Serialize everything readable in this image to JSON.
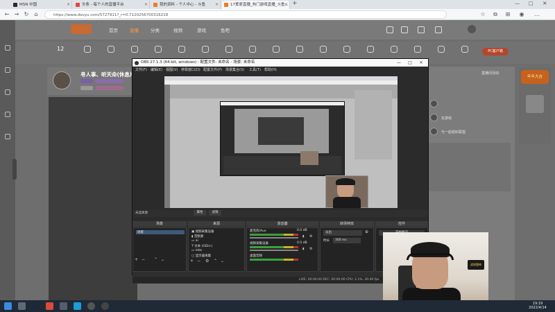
{
  "browser": {
    "tabs": [
      {
        "label": "MSN 中国",
        "color": "#2b2b2b"
      },
      {
        "label": "头条 - 每个人的直播平台",
        "color": "#e0483e"
      },
      {
        "label": "我的资料 - 个人中心 - 斗鱼",
        "color": "#6a6a6a"
      },
      {
        "label": "17爱原直播_热门游戏直播_斗鱼...",
        "color": "#f07a28"
      }
    ],
    "url": "https://www.douyu.com/5727911?_r=0.7120256700316218",
    "new_tab": "+"
  },
  "site": {
    "nav": [
      "首页",
      "直播",
      "分类",
      "视频",
      "游戏",
      "鱼吧"
    ],
    "active_nav": "直播",
    "category_count": "12",
    "pc_button": "PC客户端",
    "streamer_title": "寻人事、听天命(休息片",
    "side_items": [
      "直播间活动",
      "东游戏",
      "与一起组织联盟"
    ],
    "ad_text": "年年大吉"
  },
  "obs": {
    "title": "OBS 27.1.3 (64-bit, windows) - 配置文件: 未命名 - 场景: 未命名",
    "menu": [
      "文件(F)",
      "编辑(E)",
      "视图(V)",
      "停靠窗口(D)",
      "配置文件(P)",
      "场景集合(S)",
      "工具(T)",
      "帮助(H)"
    ],
    "no_source": "未选择源",
    "btn_props": "属性",
    "btn_filters": "滤镜",
    "docks": {
      "scenes": "场景",
      "sources": "来源",
      "mixer": "混音器",
      "transitions": "转场特效",
      "controls": "控件"
    },
    "scene_item": "场景",
    "sources": [
      "视频采集设备",
      "音频源",
      "ai",
      "文本 (GDI+)",
      "mbs",
      "显示器采集"
    ],
    "mixer": [
      {
        "name": "麦克风/Aux",
        "db": "0.0 dB"
      },
      {
        "name": "视频采集设备",
        "db": "0.0 dB"
      },
      {
        "name": "桌面音频",
        "db": "0.0 dB"
      }
    ],
    "transition": "淡出",
    "duration_label": "时长",
    "duration": "300 ms",
    "control": "开始推流",
    "status": "LIVE: 00:00:00   REC: 00:00:00   CPU: 2.1%, 30.00 fps"
  },
  "webcam": {
    "logo": "战地雷神"
  },
  "taskbar": {
    "time": "19:19",
    "date": "2022/4/14",
    "icons": [
      {
        "name": "windows-start-icon",
        "color": "#3a8be0"
      },
      {
        "name": "search-icon",
        "color": "#5c6b7a"
      },
      {
        "name": "steam-icon",
        "color": "#1b2838"
      },
      {
        "name": "app-red-icon",
        "color": "#d94b3a"
      },
      {
        "name": "folder-icon",
        "color": "#555e6a"
      },
      {
        "name": "edge-icon",
        "color": "#1f9bd8"
      },
      {
        "name": "obs-icon",
        "color": "#555"
      }
    ]
  }
}
